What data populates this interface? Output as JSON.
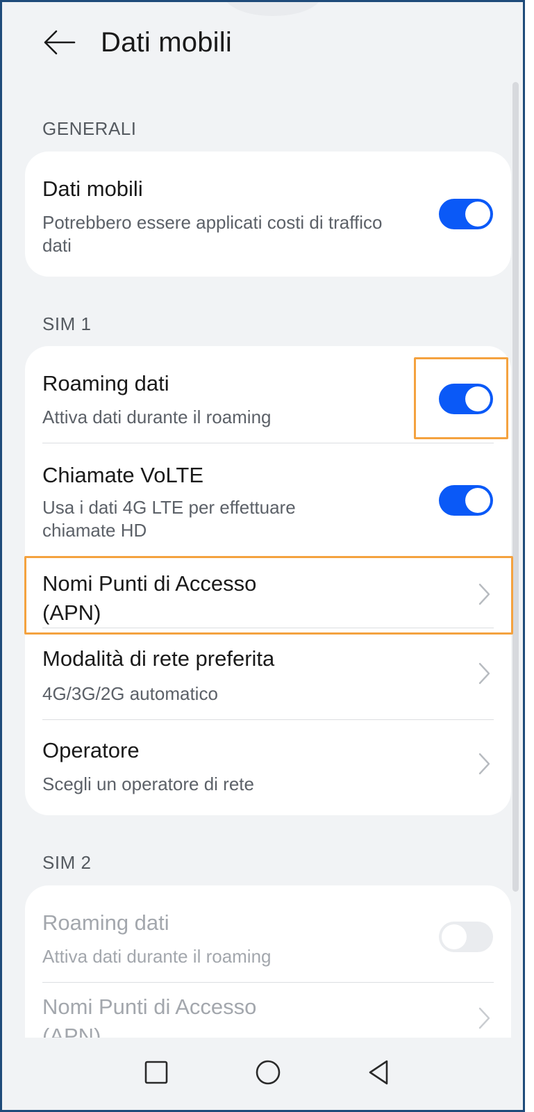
{
  "header": {
    "title": "Dati mobili"
  },
  "sections": {
    "generali": "GENERALI",
    "sim1": "SIM 1",
    "sim2": "SIM 2"
  },
  "generali": {
    "mobile_data": {
      "title": "Dati mobili",
      "subtitle": "Potrebbero essere applicati costi di traffico dati",
      "on": true
    }
  },
  "sim1": {
    "roaming": {
      "title": "Roaming dati",
      "subtitle": "Attiva dati durante il roaming",
      "on": true
    },
    "volte": {
      "title": "Chiamate VoLTE",
      "subtitle": "Usa i dati 4G LTE per effettuare chiamate HD",
      "on": true
    },
    "apn": {
      "title": "Nomi Punti di Accesso (APN)"
    },
    "network_mode": {
      "title": "Modalità di rete preferita",
      "subtitle": "4G/3G/2G automatico"
    },
    "operator": {
      "title": "Operatore",
      "subtitle": "Scegli un operatore di rete"
    }
  },
  "sim2": {
    "roaming": {
      "title": "Roaming dati",
      "subtitle": "Attiva dati durante il roaming",
      "on": false
    },
    "apn": {
      "title": "Nomi Punti di Accesso (APN)"
    }
  },
  "icons": {
    "back": "arrow-left-icon",
    "chevron": "chevron-right-icon",
    "nav_recent": "square-icon",
    "nav_home": "circle-icon",
    "nav_back": "triangle-back-icon"
  },
  "colors": {
    "accent": "#0a59f7",
    "highlight": "#f4a23f"
  }
}
